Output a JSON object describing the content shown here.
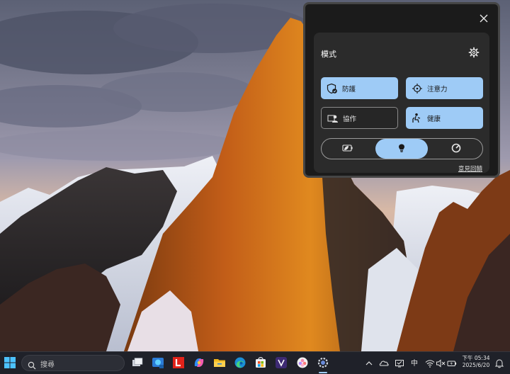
{
  "popup": {
    "title": "模式",
    "tiles": [
      {
        "label": "防護",
        "icon": "shield-check-icon",
        "active": true
      },
      {
        "label": "注意力",
        "icon": "focus-crosshair-icon",
        "active": true
      },
      {
        "label": "協作",
        "icon": "person-frame-icon",
        "active": false
      },
      {
        "label": "健康",
        "icon": "posture-icon",
        "active": true
      }
    ],
    "segments": [
      {
        "icon": "battery-leaf-icon",
        "selected": false
      },
      {
        "icon": "lightbulb-icon",
        "selected": true
      },
      {
        "icon": "speedometer-icon",
        "selected": false
      }
    ],
    "feedback_link": "意見回饋"
  },
  "taskbar": {
    "search_placeholder": "搜尋",
    "pinned_icons": [
      "task-view-icon",
      "edge-dev-icon",
      "lenovo-l-icon",
      "copilot-icon",
      "file-explorer-icon",
      "edge-icon",
      "microsoft-store-icon",
      "vantage-icon",
      "photos-icon",
      "smart-modes-icon"
    ],
    "tray": {
      "ime_label": "中",
      "time": "下午 05:34",
      "date": "2025/6/20"
    }
  },
  "colors": {
    "accent": "#9ecbf6",
    "panel": "#1b1b1b",
    "inner_panel": "#2b2b2b",
    "taskbar": "#1f2129"
  }
}
